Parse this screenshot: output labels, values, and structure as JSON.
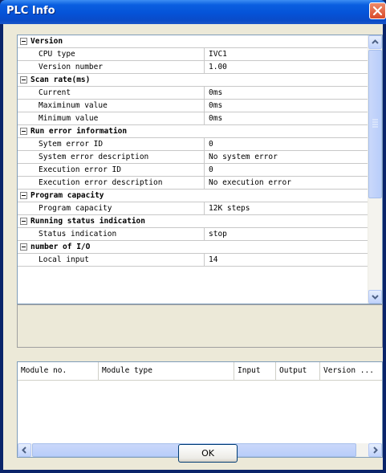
{
  "window": {
    "title": "PLC Info",
    "title_color": "#ffffff",
    "titlebar_color": "#0553d8"
  },
  "properties": [
    {
      "type": "category",
      "label": "Version"
    },
    {
      "type": "item",
      "name": "CPU type",
      "value": "IVC1"
    },
    {
      "type": "item",
      "name": "Version number",
      "value": "1.00"
    },
    {
      "type": "category",
      "label": "Scan rate(ms)"
    },
    {
      "type": "item",
      "name": "Current",
      "value": "0ms"
    },
    {
      "type": "item",
      "name": "Maximinum value",
      "value": "0ms"
    },
    {
      "type": "item",
      "name": "Minimum value",
      "value": "0ms"
    },
    {
      "type": "category",
      "label": "Run error information"
    },
    {
      "type": "item",
      "name": "Sytem error ID",
      "value": "0"
    },
    {
      "type": "item",
      "name": "System error description",
      "value": "No system error"
    },
    {
      "type": "item",
      "name": "Execution error ID",
      "value": "0"
    },
    {
      "type": "item",
      "name": "Execution error description",
      "value": "No execution error"
    },
    {
      "type": "category",
      "label": "Program capacity"
    },
    {
      "type": "item",
      "name": "Program capacity",
      "value": "12K steps"
    },
    {
      "type": "category",
      "label": "Running status indication"
    },
    {
      "type": "item",
      "name": "Status indication",
      "value": "stop"
    },
    {
      "type": "category",
      "label": "number of I/O"
    },
    {
      "type": "item",
      "name": "Local input",
      "value": "14"
    }
  ],
  "module_table": {
    "columns": [
      "Module no.",
      "Module type",
      "Input",
      "Output",
      "Version ..."
    ]
  },
  "buttons": {
    "ok": "OK"
  },
  "icons": {
    "close": "close-icon",
    "scroll_up": "arrow-up-icon",
    "scroll_down": "arrow-down-icon",
    "scroll_left": "arrow-left-icon",
    "scroll_right": "arrow-right-icon",
    "collapse": "minus-box-icon"
  }
}
